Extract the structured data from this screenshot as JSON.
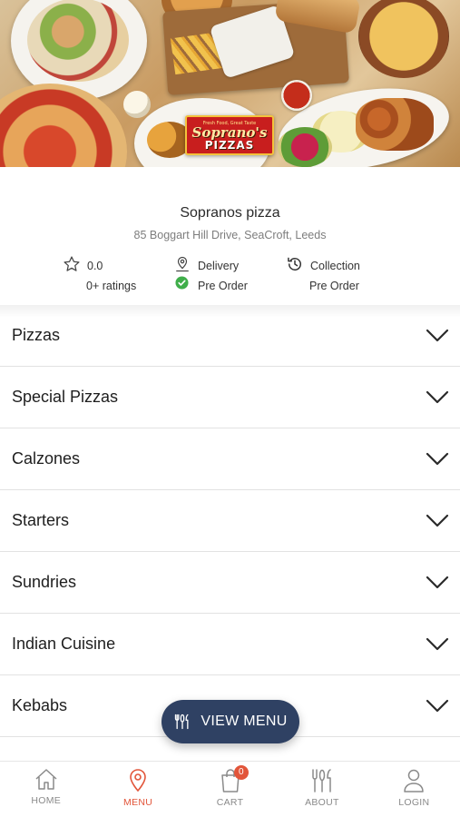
{
  "hero": {
    "logo_top": "Soprano's",
    "logo_bottom": "PIZZAS",
    "logo_tagline": "Fresh Food, Great Taste"
  },
  "restaurant": {
    "name": "Sopranos pizza",
    "address": "85 Boggart Hill Drive, SeaCroft, Leeds",
    "rating": "0.0",
    "ratings_count": "0+ ratings",
    "delivery_label": "Delivery",
    "delivery_mode": "Pre Order",
    "collection_label": "Collection",
    "collection_mode": "Pre Order"
  },
  "categories": [
    {
      "label": "Pizzas"
    },
    {
      "label": "Special Pizzas"
    },
    {
      "label": "Calzones"
    },
    {
      "label": "Starters"
    },
    {
      "label": "Sundries"
    },
    {
      "label": "Indian Cuisine"
    },
    {
      "label": "Kebabs"
    }
  ],
  "view_menu": {
    "label": "VIEW MENU"
  },
  "bottom_nav": {
    "home": "HOME",
    "menu": "MENU",
    "cart": "CART",
    "cart_count": "0",
    "about": "ABOUT",
    "login": "LOGIN"
  },
  "colors": {
    "accent": "#e2553a",
    "pill": "#2f4163",
    "check": "#3fae4a"
  },
  "icons": {
    "rating": "star-icon",
    "delivery": "map-pin-icon",
    "check": "check-circle-icon",
    "collection": "history-clock-icon",
    "category_toggle": "chevron-down-icon",
    "view_menu": "cutlery-icon",
    "home": "home-icon",
    "menu": "location-pin-icon",
    "cart": "shopping-bag-icon",
    "about": "fork-knife-icon",
    "login": "user-icon"
  }
}
